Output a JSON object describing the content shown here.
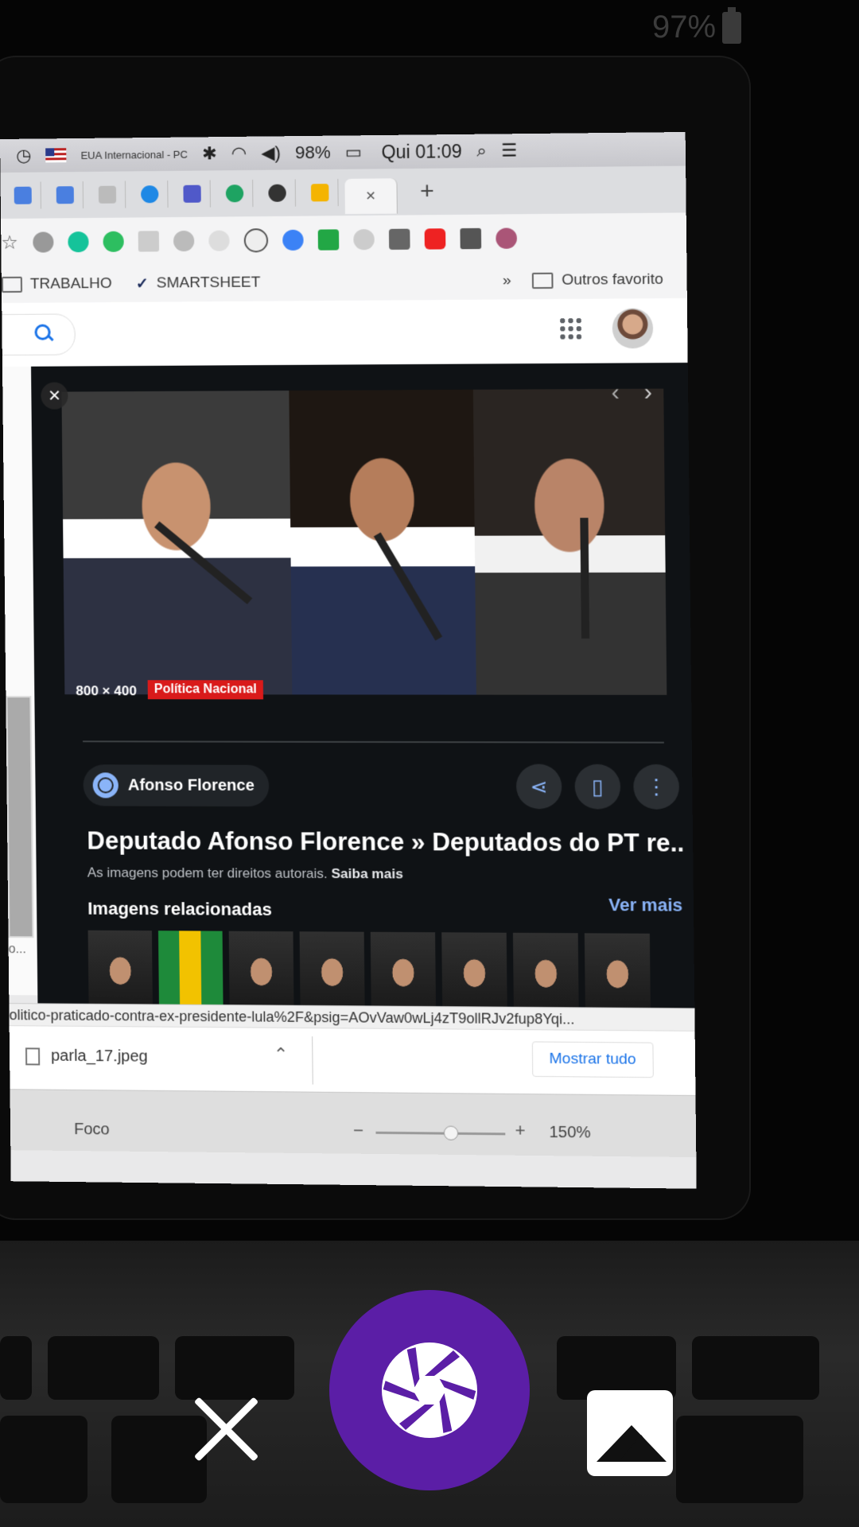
{
  "phone_status": {
    "battery": "97%"
  },
  "menubar": {
    "locale": "EUA Internacional - PC",
    "battery": "98%",
    "clock": "Qui 01:09"
  },
  "bookmarks": {
    "items": [
      "TRABALHO",
      "SMARTSHEET"
    ],
    "overflow": "»",
    "other": "Outros favorito"
  },
  "image_preview": {
    "dimensions": "800 × 400",
    "source_tag": "Política Nacional",
    "site_name": "Afonso Florence",
    "title": "Deputado Afonso Florence » Deputados do PT re...",
    "copyright_text": "As imagens podem ter direitos autorais.",
    "learn_more": "Saiba mais",
    "related_heading": "Imagens relacionadas",
    "see_more": "Ver mais"
  },
  "status_url": "olitico-praticado-contra-ex-presidente-lula%2F&psig=AOvVaw0wLj4zT9ollRJv2fup8Yqi...",
  "download_bar": {
    "filename": "parla_17.jpeg",
    "show_all": "Mostrar tudo"
  },
  "word_status": {
    "focus": "Foco",
    "zoom": "150%"
  },
  "left_result": {
    "caption": "o..."
  },
  "colors": {
    "shutter": "#5b1ea6",
    "link": "#8ab4f8",
    "source_tag": "#d91a1a"
  },
  "icons": [
    "close-icon",
    "shutter-icon",
    "gallery-icon",
    "share-icon",
    "bookmark-icon",
    "more-vert-icon",
    "apps-grid-icon",
    "search-icon"
  ]
}
